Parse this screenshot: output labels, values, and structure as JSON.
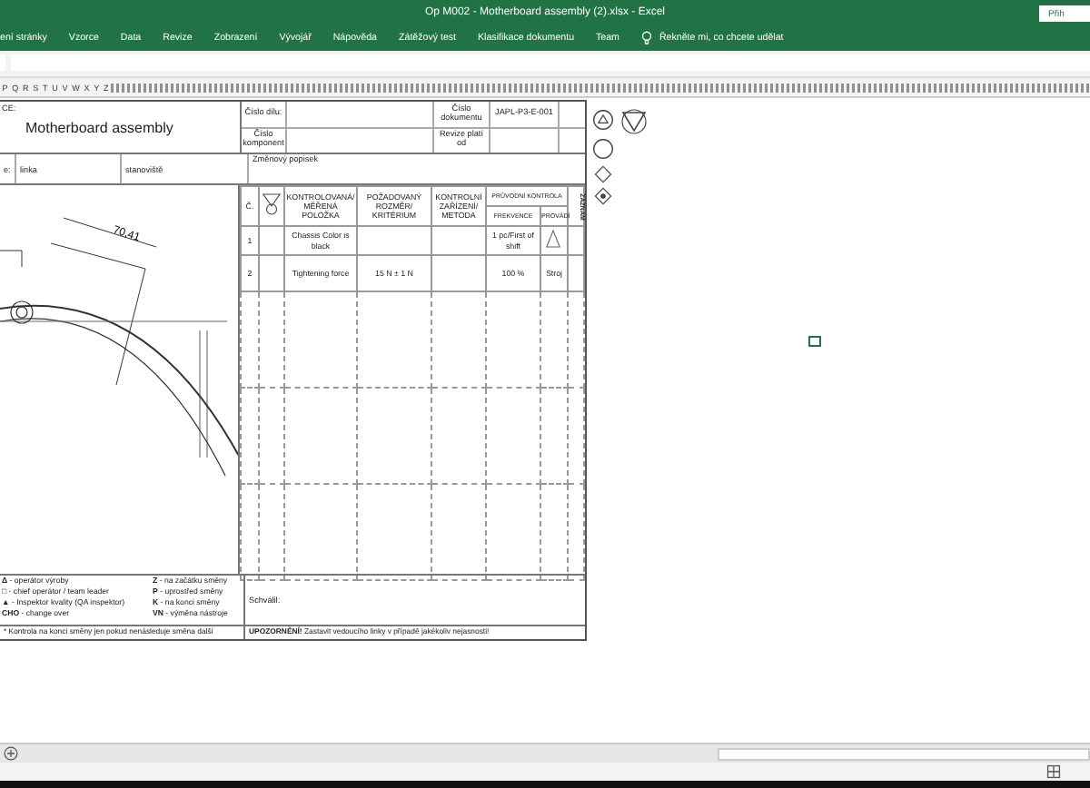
{
  "window": {
    "title": "Op M002 - Motherboard assembly (2).xlsx  -  Excel",
    "sign_in": "Přih"
  },
  "ribbon_tabs": [
    {
      "label": "ení stránky",
      "selected": false
    },
    {
      "label": "Vzorce",
      "selected": false
    },
    {
      "label": "Data",
      "selected": false
    },
    {
      "label": "Revize",
      "selected": false
    },
    {
      "label": "Zobrazení",
      "selected": false
    },
    {
      "label": "Vývojář",
      "selected": false
    },
    {
      "label": "Nápověda",
      "selected": false
    },
    {
      "label": "Zátěžový test",
      "selected": false
    },
    {
      "label": "Klasifikace dokumentu",
      "selected": false
    },
    {
      "label": "Team",
      "selected": false
    }
  ],
  "tell_me": "Řekněte mi, co chcete udělat",
  "column_headers": [
    "P",
    "Q",
    "R",
    "S",
    "T",
    "U",
    "V",
    "W",
    "X",
    "Y",
    "Z"
  ],
  "form": {
    "corner_label": "CE:",
    "title": "Motherboard assembly",
    "header_cells": [
      {
        "label": "Číslo dílu:"
      },
      {
        "label": "Číslo dokumentu",
        "value": "JAPL-P3-E-001"
      },
      {
        "label": "Číslo komponent"
      },
      {
        "label": "Revize platí od"
      }
    ],
    "row_labels": [
      "e:",
      "linka",
      "stanoviště"
    ],
    "change_label": "Změnový popisek",
    "dimension": "70,41",
    "table": {
      "columns": [
        "Č.",
        "KONTROLOVANÁ/ MĚŘENÁ POLOŽKA",
        "POŽADOVANÝ ROZMĚR/ KRITÉRIUM",
        "KONTROLNÍ ZAŘÍZENÍ/ METODA",
        "PRŮVODNÍ KONTROLA",
        "ZÁZNAM"
      ],
      "subcolumns": [
        "FREKVENCE",
        "PROVÁDÍ"
      ],
      "rows": [
        {
          "no": "1",
          "item": "Chassis Color is black",
          "frequency": "1 pc/First of shift",
          "kind": "triangle"
        },
        {
          "no": "2",
          "item": "Tightening force",
          "criterion": "15 N ± 1 N",
          "frequency": "100 %",
          "performer": "Stroj",
          "kind": "text"
        }
      ]
    },
    "legend_left": [
      {
        "symbol": "Δ",
        "text": " - operátor výroby"
      },
      {
        "symbol": "□",
        "text": " - chief operátor / team leader"
      },
      {
        "symbol": "▲",
        "text": " - Inspektor kvality (QA inspektor)"
      },
      {
        "symbol": "CHO",
        "text": " - change over"
      }
    ],
    "legend_right": [
      {
        "symbol": "Z",
        "text": " - na začátku směny"
      },
      {
        "symbol": "P",
        "text": " - uprostřed směny"
      },
      {
        "symbol": "K",
        "text": " - na konci směny"
      },
      {
        "symbol": "VN",
        "text": " - výměna nástroje"
      }
    ],
    "approved": "Schválil:",
    "footnote": "*   Kontrola na konci směny jen pokud nenásleduje směna další",
    "warning": "**UPOZORNĚNÍ!** Zastavit vedoucího linky v případě jakékoliv nejasnosti!"
  }
}
